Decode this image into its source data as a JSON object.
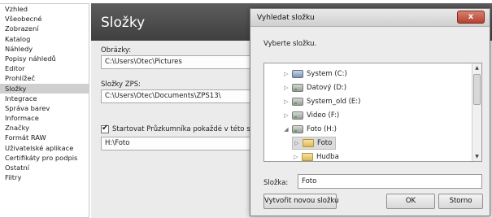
{
  "sidebar": {
    "items": [
      {
        "label": "Vzhled"
      },
      {
        "label": "Všeobecné"
      },
      {
        "label": "Zobrazení"
      },
      {
        "label": "Katalog"
      },
      {
        "label": "Náhledy"
      },
      {
        "label": "Popisy náhledů"
      },
      {
        "label": "Editor"
      },
      {
        "label": "Prohlížeč"
      },
      {
        "label": "Složky",
        "selected": true
      },
      {
        "label": "Integrace"
      },
      {
        "label": "Správa barev"
      },
      {
        "label": "Informace"
      },
      {
        "label": "Značky"
      },
      {
        "label": "Formát RAW"
      },
      {
        "label": "Uživatelské aplikace"
      },
      {
        "label": "Certifikáty pro podpis"
      },
      {
        "label": "Ostatní"
      },
      {
        "label": "Filtry"
      }
    ]
  },
  "main": {
    "title": "Složky",
    "pictures_label": "Obrázky:",
    "pictures_path": "C:\\Users\\Otec\\Pictures",
    "zps_label": "Složky ZPS:",
    "zps_path": "C:\\Users\\Otec\\Documents\\ZPS13\\",
    "startup_checkbox_label": "Startovat Průzkumníka pokaždé v této složce:",
    "startup_checked": true,
    "startup_path": "H:\\Foto"
  },
  "dialog": {
    "title": "Vyhledat složku",
    "close_label": "x",
    "prompt": "Vyberte složku.",
    "tree": [
      {
        "label": "System (C:)",
        "icon": "system-drive-icon",
        "level": 0,
        "arrow": "▷"
      },
      {
        "label": "Datový (D:)",
        "icon": "drive-icon",
        "level": 0,
        "arrow": "▷"
      },
      {
        "label": "System_old (E:)",
        "icon": "drive-icon",
        "level": 0,
        "arrow": "▷"
      },
      {
        "label": "Video (F:)",
        "icon": "drive-icon",
        "level": 0,
        "arrow": "▷"
      },
      {
        "label": "Foto (H:)",
        "icon": "drive-icon",
        "level": 0,
        "arrow": "◢"
      },
      {
        "label": "Foto",
        "icon": "folder-icon",
        "level": 1,
        "arrow": "▷",
        "selected": true
      },
      {
        "label": "Hudba",
        "icon": "folder-icon",
        "level": 1,
        "arrow": "▷"
      }
    ],
    "folder_label": "Složka:",
    "folder_value": "Foto",
    "new_folder_button": "Vytvořit novou složku",
    "ok_button": "OK",
    "cancel_button": "Storno"
  }
}
